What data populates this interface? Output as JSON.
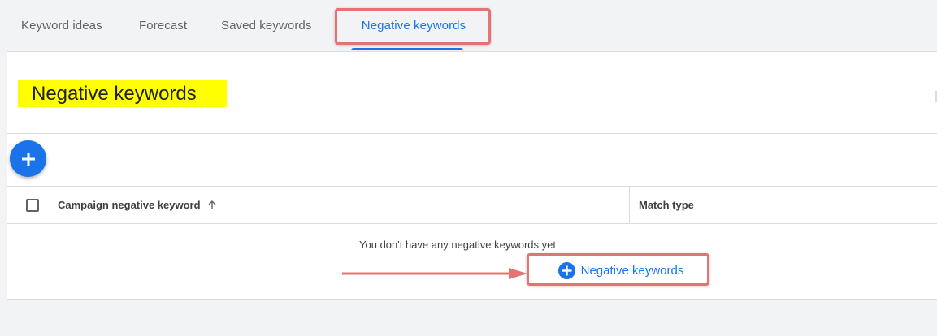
{
  "tabs": [
    {
      "label": "Keyword ideas"
    },
    {
      "label": "Forecast"
    },
    {
      "label": "Saved keywords"
    },
    {
      "label": "Negative keywords",
      "active": true
    }
  ],
  "page": {
    "title": "Negative keywords"
  },
  "toolbar": {
    "add_icon": "plus-icon"
  },
  "table": {
    "columns": [
      {
        "label": "Campaign negative keyword",
        "sort": "ascending"
      },
      {
        "label": "Match type"
      }
    ]
  },
  "empty_state": {
    "message": "You don't have any negative keywords yet",
    "add_label": "Negative keywords"
  },
  "colors": {
    "accent": "#1a73e8",
    "annotation_border": "#e57373",
    "title_highlight": "#ffff00"
  }
}
